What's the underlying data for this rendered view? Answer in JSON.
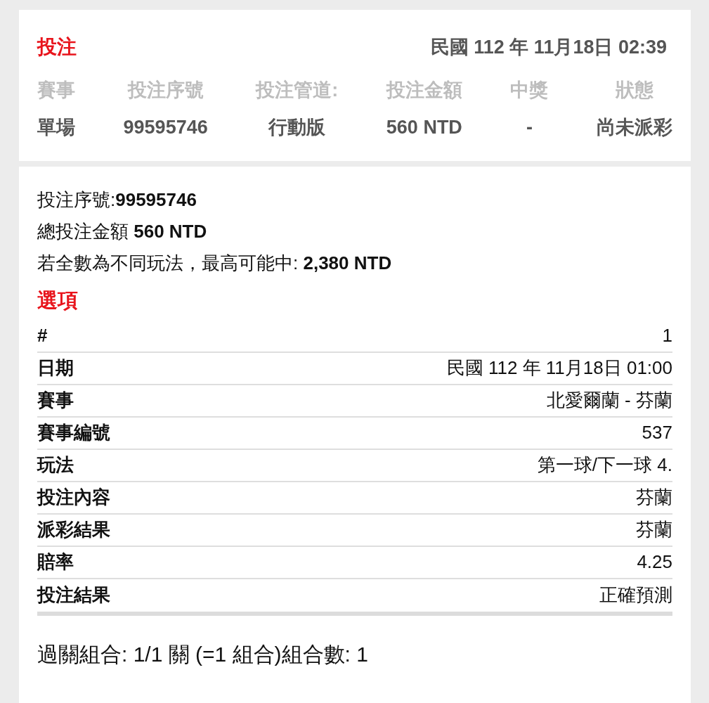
{
  "header": {
    "title": "投注",
    "datetime": "民國 112 年 11月18日 02:39",
    "columns": [
      {
        "label": "賽事",
        "value": "單場"
      },
      {
        "label": "投注序號",
        "value": "99595746"
      },
      {
        "label": "投注管道:",
        "value": "行動版"
      },
      {
        "label": "投注金額",
        "value": "560 NTD"
      },
      {
        "label": "中獎",
        "value": "-"
      },
      {
        "label": "狀態",
        "value": "尚未派彩"
      }
    ]
  },
  "summary": [
    "投注序號:**99595746**",
    "總投注金額 **560 NTD**",
    "若全數為不同玩法，最高可能中: **2,380 NTD**"
  ],
  "options_title": "選項",
  "details": [
    {
      "label": "#",
      "value": "1"
    },
    {
      "label": "日期",
      "value": "民國 112 年 11月18日 01:00"
    },
    {
      "label": "賽事",
      "value": "北愛爾蘭 - 芬蘭"
    },
    {
      "label": "賽事編號",
      "value": "537"
    },
    {
      "label": "玩法",
      "value": "第一球/下一球 4."
    },
    {
      "label": "投注內容",
      "value": "芬蘭"
    },
    {
      "label": "派彩結果",
      "value": "芬蘭"
    },
    {
      "label": "賠率",
      "value": "4.25"
    },
    {
      "label": "投注結果",
      "value": "正確預測"
    }
  ],
  "combination": "過關組合: 1/1 關 (=1 組合)組合數: 1"
}
